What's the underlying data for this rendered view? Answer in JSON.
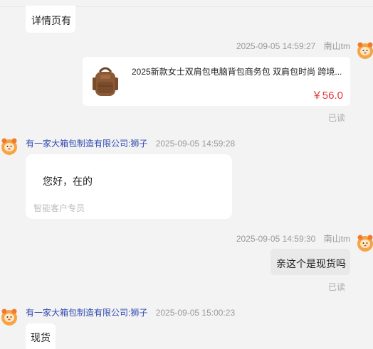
{
  "messages": [
    {
      "type": "text",
      "side": "left",
      "text": "详情页有"
    },
    {
      "type": "product",
      "side": "right",
      "time": "2025-09-05 14:59:27",
      "sender": "南山tm",
      "product": {
        "title": "2025新款女士双肩包电脑背包商务包 双肩包时尚 跨境...",
        "price": "￥56.0"
      },
      "status": "已读"
    },
    {
      "type": "text-card",
      "side": "left",
      "sender": "有一家大箱包制造有限公司:狮子",
      "time": "2025-09-05 14:59:28",
      "text": "您好，在的",
      "footer": "智能客户专员"
    },
    {
      "type": "text",
      "side": "right",
      "time": "2025-09-05 14:59:30",
      "sender": "南山tm",
      "text": "亲这个是现货吗",
      "status": "已读"
    },
    {
      "type": "text",
      "side": "left",
      "sender": "有一家大箱包制造有限公司:狮子",
      "time": "2025-09-05 15:00:23",
      "text": "现货"
    }
  ],
  "colors": {
    "price": "#e4393c",
    "sender_link": "#2f4bb0",
    "meta": "#9a9a9a",
    "background": "#f3f3f3"
  },
  "icons": {
    "avatar": "lion-avatar-icon",
    "product_image": "backpack-image"
  }
}
